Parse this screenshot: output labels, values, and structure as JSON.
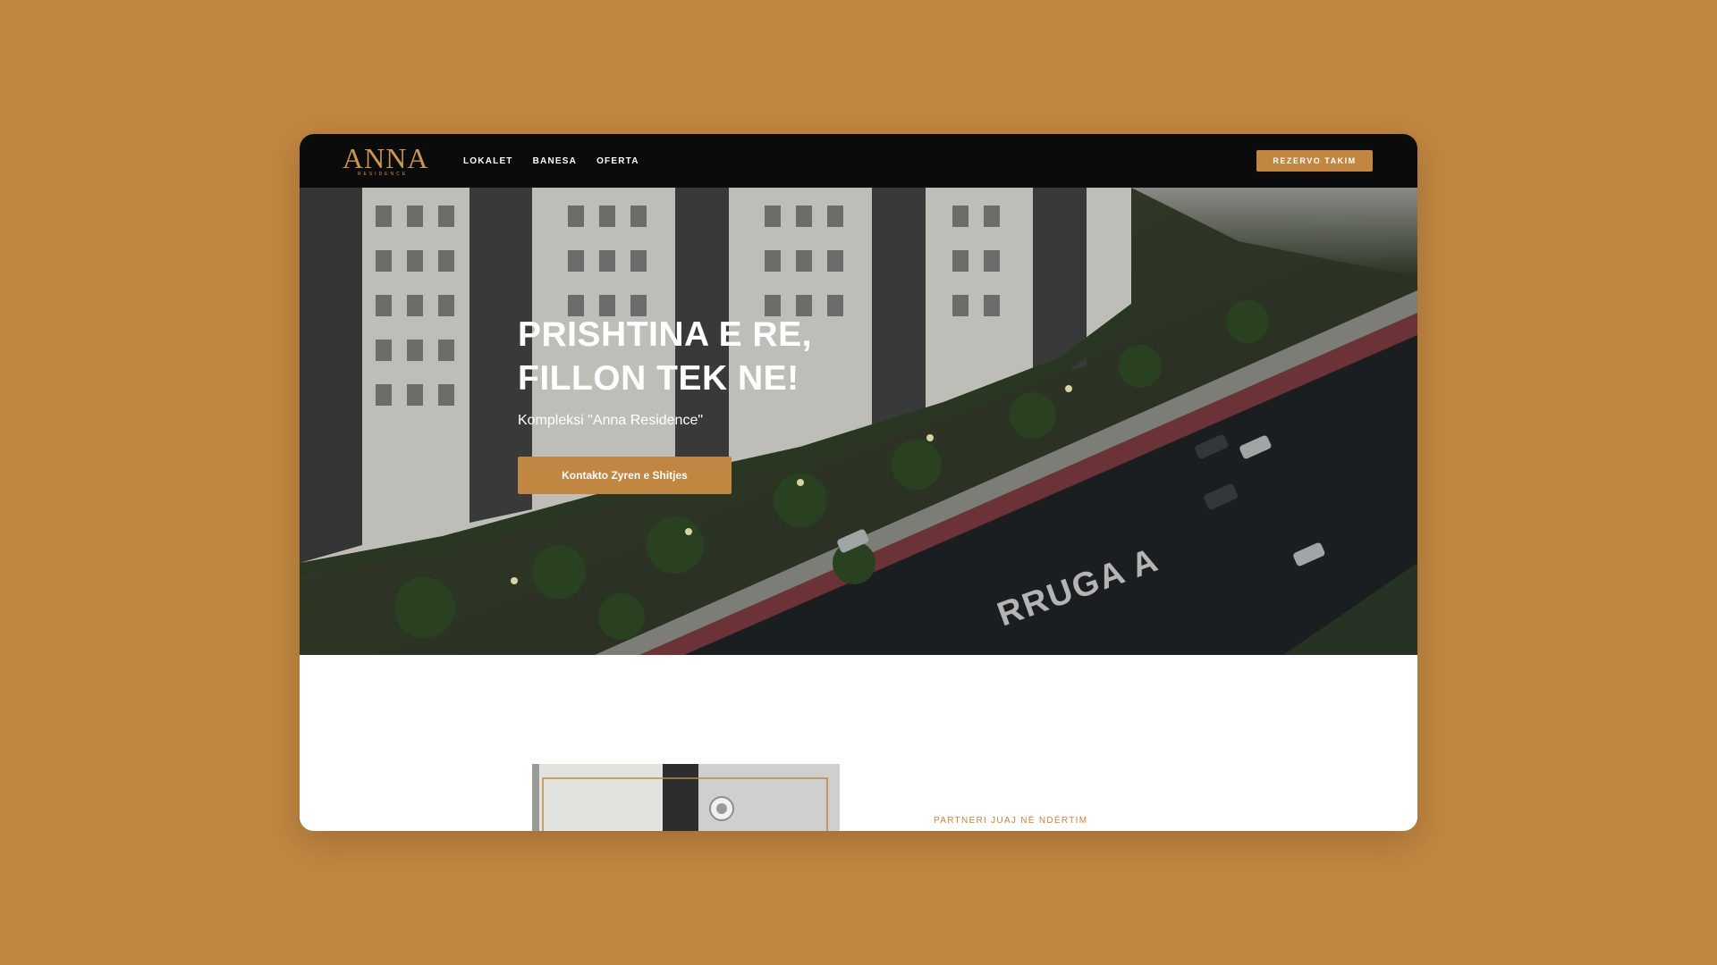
{
  "colors": {
    "background": "#C18641",
    "accent": "#C18641",
    "nav_bg": "#0b0b0b"
  },
  "header": {
    "logo_text": "ANNA",
    "logo_sub": "RESIDENCE",
    "nav_items": [
      {
        "label": "LOKALET"
      },
      {
        "label": "BANESA"
      },
      {
        "label": "OFERTA"
      }
    ],
    "cta_label": "REZERVO TAKIM"
  },
  "hero": {
    "title_line1": "PRISHTINA E RE,",
    "title_line2": "FILLON TEK NE!",
    "subtitle": "Kompleksi \"Anna Residence\"",
    "button_label": "Kontakto Zyren e Shitjes",
    "road_label": "RRUGA A"
  },
  "section": {
    "eyebrow": "PARTNERI JUAJ NË NDËRTIM"
  }
}
